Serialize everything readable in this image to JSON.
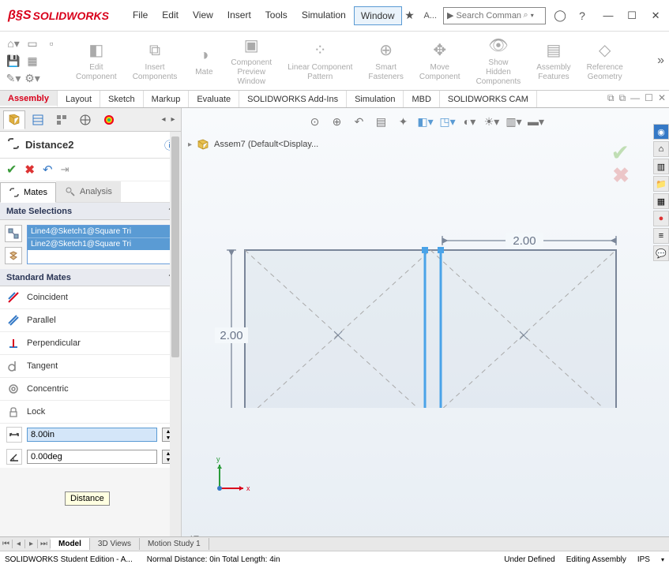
{
  "app": {
    "brand": "SOLIDWORKS",
    "search_placeholder": "Search Comman",
    "search_extra": "A..."
  },
  "menu": {
    "items": [
      "File",
      "Edit",
      "View",
      "Insert",
      "Tools",
      "Simulation",
      "Window"
    ],
    "active_index": 6
  },
  "ribbon": {
    "groups": [
      {
        "label": "Edit\nComponent"
      },
      {
        "label": "Insert\nComponents"
      },
      {
        "label": "Mate"
      },
      {
        "label": "Component\nPreview\nWindow"
      },
      {
        "label": "Linear Component\nPattern"
      },
      {
        "label": "Smart\nFasteners"
      },
      {
        "label": "Move\nComponent"
      },
      {
        "label": "Show\nHidden\nComponents"
      },
      {
        "label": "Assembly\nFeatures"
      },
      {
        "label": "Reference\nGeometry"
      }
    ]
  },
  "maintabs": {
    "items": [
      "Assembly",
      "Layout",
      "Sketch",
      "Markup",
      "Evaluate",
      "SOLIDWORKS Add-Ins",
      "Simulation",
      "MBD",
      "SOLIDWORKS CAM"
    ],
    "active_index": 0
  },
  "property": {
    "name": "Distance2",
    "mates_tab": "Mates",
    "analysis_tab": "Analysis",
    "selections_header": "Mate Selections",
    "selections": [
      "Line4@Sketch1@Square Tri",
      "Line2@Sketch1@Square Tri"
    ],
    "standard_header": "Standard Mates",
    "mates": {
      "coincident": "Coincident",
      "parallel": "Parallel",
      "perpendicular": "Perpendicular",
      "tangent": "Tangent",
      "concentric": "Concentric",
      "lock": "Lock"
    },
    "distance_value": "8.00in",
    "angle_value": "0.00deg",
    "tooltip": "Distance"
  },
  "viewport": {
    "breadcrumb": "Assem7  (Default<Display...",
    "dim_h": "2.00",
    "dim_v": "2.00",
    "viewname": "*Front",
    "triad_x": "x",
    "triad_y": "y"
  },
  "bottomtabs": {
    "items": [
      "Model",
      "3D Views",
      "Motion Study 1"
    ],
    "active_index": 0
  },
  "status": {
    "left": "SOLIDWORKS Student Edition - A...",
    "mid": "Normal Distance: 0in Total Length: 4in",
    "under": "Under Defined",
    "editing": "Editing Assembly",
    "units": "IPS"
  }
}
